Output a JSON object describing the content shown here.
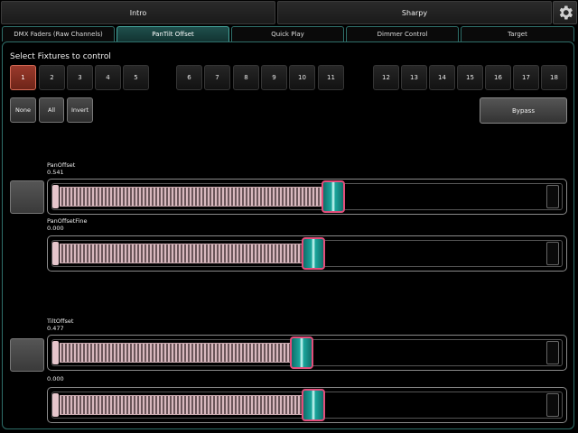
{
  "scene_tabs": [
    "Intro",
    "Sharpy"
  ],
  "page_tabs": [
    {
      "label": "DMX Faders (Raw Channels)",
      "active": false
    },
    {
      "label": "PanTilt Offset",
      "active": true
    },
    {
      "label": "Quick Play",
      "active": false
    },
    {
      "label": "Dimmer Control",
      "active": false
    },
    {
      "label": "Target",
      "active": false
    }
  ],
  "section_title": "Select Fixtures to control",
  "fixtures": [
    "1",
    "2",
    "3",
    "4",
    "5",
    "6",
    "7",
    "8",
    "9",
    "10",
    "11",
    "12",
    "13",
    "14",
    "15",
    "16",
    "17",
    "18"
  ],
  "selected_fixture": "1",
  "controls": {
    "none": "None",
    "all": "All",
    "invert": "Invert",
    "bypass": "Bypass"
  },
  "faders": [
    {
      "label": "PanOffset",
      "value": "0.541",
      "level": 0.541
    },
    {
      "label": "PanOffsetFine",
      "value": "0.000",
      "level": 0.5
    },
    {
      "label": "TiltOffset",
      "value": "0.477",
      "level": 0.477
    },
    {
      "label": "",
      "value": "0.000",
      "level": 0.5
    }
  ],
  "colors": {
    "accent": "#46a59d",
    "selected": "#9a3a2c",
    "knob_border": "#e24d7a"
  },
  "icons": {
    "settings": "gear-icon"
  }
}
